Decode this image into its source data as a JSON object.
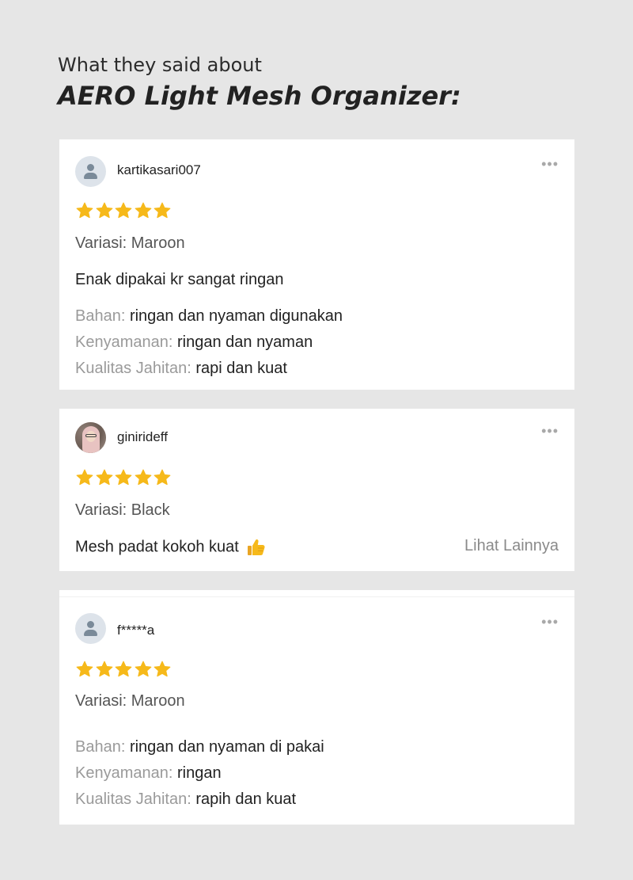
{
  "header": {
    "subtitle": "What they said about",
    "title": "AERO Light Mesh Organizer:"
  },
  "colors": {
    "background": "#e6e6e6",
    "card": "#ffffff",
    "star": "#f6b91a",
    "muted_label": "#9a9a9a"
  },
  "reviews": [
    {
      "username": "kartikasari007",
      "avatar": "default-user-icon",
      "rating": 5,
      "variant": "Variasi: Maroon",
      "comment": "Enak dipakai kr sangat ringan",
      "attributes": [
        {
          "label": "Bahan:",
          "value": "ringan dan nyaman digunakan"
        },
        {
          "label": "Kenyamanan:",
          "value": "ringan dan nyaman"
        },
        {
          "label": "Kualitas Jahitan:",
          "value": "rapi dan kuat"
        }
      ],
      "more_icon": "•••"
    },
    {
      "username": "ginirideff",
      "avatar": "photo-avatar",
      "rating": 5,
      "variant": "Variasi: Black",
      "comment": "Mesh padat kokoh kuat",
      "comment_emoji": "thumbs-up-icon",
      "see_more": "Lihat Lainnya",
      "more_icon": "•••"
    },
    {
      "username": "f*****a",
      "avatar": "default-user-icon",
      "rating": 5,
      "variant": "Variasi: Maroon",
      "attributes": [
        {
          "label": "Bahan:",
          "value": "ringan dan nyaman di pakai"
        },
        {
          "label": "Kenyamanan:",
          "value": "ringan"
        },
        {
          "label": "Kualitas Jahitan:",
          "value": "rapih dan kuat"
        }
      ],
      "more_icon": "•••"
    }
  ]
}
